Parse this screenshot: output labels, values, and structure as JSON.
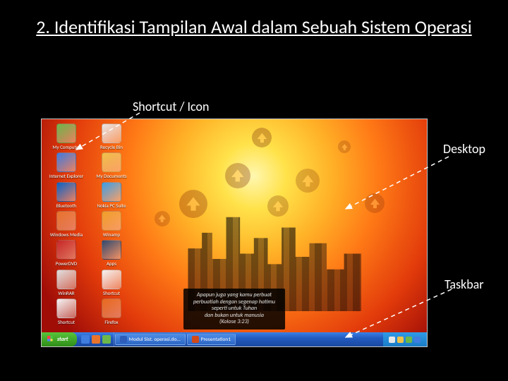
{
  "title": "2. Identifikasi Tampilan Awal dalam Sebuah Sistem Operasi",
  "annotations": {
    "shortcut": "Shortcut / Icon",
    "desktop": "Desktop",
    "taskbar": "Taskbar"
  },
  "desktop_icons": [
    {
      "label": "My Computer",
      "color": "#6db84a"
    },
    {
      "label": "Recycle Bin",
      "color": "#e8e8e8"
    },
    {
      "label": "Internet Explorer",
      "color": "#3f7de0"
    },
    {
      "label": "My Documents",
      "color": "#f0c24a"
    },
    {
      "label": "Bluetooth",
      "color": "#0a64c8"
    },
    {
      "label": "Nokia PC Suite",
      "color": "#3aa0e8"
    },
    {
      "label": "Windows Media",
      "color": "#e8742c"
    },
    {
      "label": "Winamp",
      "color": "#f0a028"
    },
    {
      "label": "PowerDVD",
      "color": "#c82828"
    },
    {
      "label": "Apps",
      "color": "#304a70"
    },
    {
      "label": "WinRAR",
      "color": "#e0e0e0"
    },
    {
      "label": "Shortcut",
      "color": "#f4f4f4"
    },
    {
      "label": "Shortcut",
      "color": "#f4f4f4"
    },
    {
      "label": "Firefox",
      "color": "#e86a1e"
    }
  ],
  "quote": {
    "line1": "Apapun juga yang kamu perbuat",
    "line2": "perbuatlah dengan segenap hatimu",
    "line3": "seperti untuk Tuhan",
    "line4": "dan bukan untuk manusia",
    "ref": "(Kolose 3:23)"
  },
  "taskbar": {
    "start": "start",
    "task1": "Modul Sist. operasi.do…",
    "task2": "Presentation1",
    "clock": ""
  }
}
